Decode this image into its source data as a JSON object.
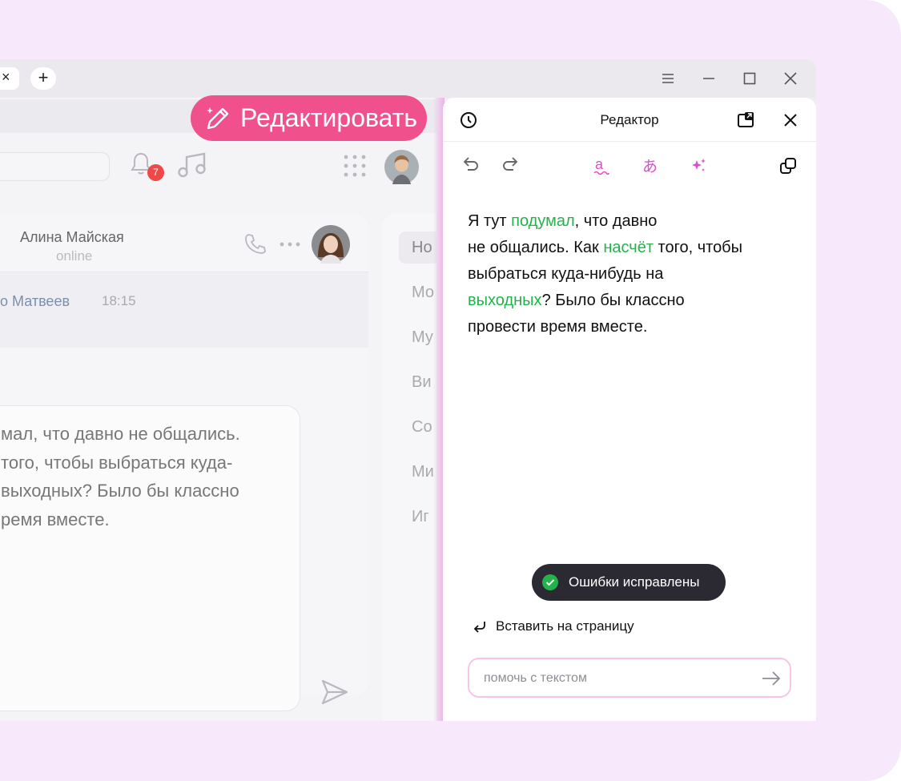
{
  "browser": {
    "new_tab_symbol": "+",
    "tab_close_symbol": "×"
  },
  "toolbar": {
    "notifications_count": "7"
  },
  "chat": {
    "contact_name": "Алина Майская",
    "contact_status": "online",
    "sender": "о Матвеев",
    "time": "18:15",
    "message_lines": [
      "мал, что давно не общались.",
      "того, чтобы выбраться куда-",
      "выходных? Было бы классно",
      "ремя вместе."
    ]
  },
  "side_menu": {
    "items": [
      "Но",
      "Мо",
      "Му",
      "Ви",
      "Со",
      "Ми",
      "Иг"
    ]
  },
  "edit_button": {
    "label": "Редактировать"
  },
  "editor": {
    "title": "Редактор",
    "text_lines": [
      [
        {
          "t": "Я тут "
        },
        {
          "t": "подумал",
          "fix": true
        },
        {
          "t": ", что давно"
        }
      ],
      [
        {
          "t": "не общались. Как "
        },
        {
          "t": "насчёт",
          "fix": true
        },
        {
          "t": " того, чтобы"
        }
      ],
      [
        {
          "t": "выбраться куда-нибудь на"
        }
      ],
      [
        {
          "t": "выходных",
          "fix": true
        },
        {
          "t": "? Было бы классно"
        }
      ],
      [
        {
          "t": "провести время вместе."
        }
      ]
    ],
    "toast": "Ошибки исправлены",
    "insert_label": "Вставить на страницу",
    "prompt_placeholder": "помочь с текстом"
  },
  "colors": {
    "accent_pink": "#f0508c",
    "fix_green": "#22b34a",
    "tool_magenta": "#e04bd0",
    "badge_red": "#f04848"
  },
  "icons": [
    "close-icon",
    "plus-icon",
    "menu-icon",
    "minimize-icon",
    "maximize-icon",
    "bell-icon",
    "music-icon",
    "apps-grid-icon",
    "avatar",
    "phone-icon",
    "more-icon",
    "send-icon",
    "pencil-sparkle-icon",
    "history-icon",
    "picture-in-picture-icon",
    "undo-icon",
    "redo-icon",
    "spellcheck-icon",
    "translate-icon",
    "sparkles-icon",
    "copy-icon",
    "check-circle-icon",
    "return-arrow-icon",
    "arrow-right-icon"
  ]
}
